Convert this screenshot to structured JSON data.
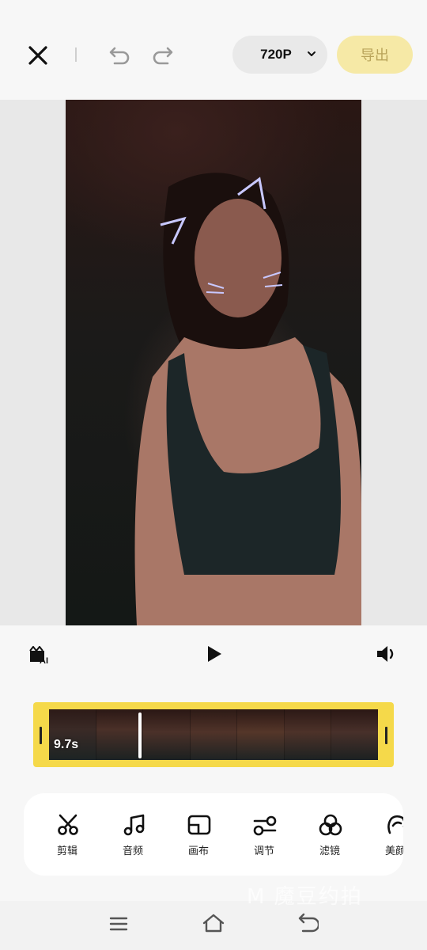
{
  "header": {
    "resolution": "720P",
    "export_label": "导出"
  },
  "icons": {
    "close": "close-icon",
    "undo": "undo-icon",
    "redo": "redo-icon",
    "dropdown": "chevron-down-icon",
    "ai_video": "ai-video-icon",
    "play": "play-icon",
    "volume": "volume-icon"
  },
  "timeline": {
    "duration": "9.7s"
  },
  "tools": [
    {
      "label": "剪辑",
      "icon": "scissors-icon"
    },
    {
      "label": "音频",
      "icon": "music-note-icon"
    },
    {
      "label": "画布",
      "icon": "canvas-icon"
    },
    {
      "label": "调节",
      "icon": "sliders-icon"
    },
    {
      "label": "滤镜",
      "icon": "filter-circles-icon"
    },
    {
      "label": "美颜",
      "icon": "beauty-face-icon"
    }
  ],
  "watermark": "M 魔豆约拍",
  "colors": {
    "accent": "#f5d94a",
    "export_bg": "#f6e9a6",
    "export_text": "#b9a45a"
  }
}
